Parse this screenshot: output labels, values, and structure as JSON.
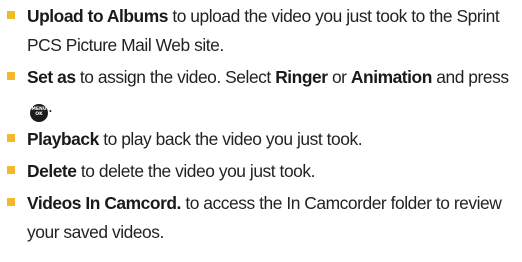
{
  "colors": {
    "bullet": "#f2b92c",
    "text": "#222222",
    "key_fill": "#1c1c1c"
  },
  "items": [
    {
      "term": "Upload to Albums",
      "text": " to upload the video you just took to the Sprint PCS Picture Mail Web site."
    },
    {
      "term": "Set as",
      "text_a": " to assign the video. Select ",
      "term_b": "Ringer",
      "text_b": " or ",
      "term_c": "Animation",
      "text_c": " and press",
      "key_icon": "menu-ok-key-icon",
      "key_line1": "MENU",
      "key_line2": "OK",
      "text_d": "."
    },
    {
      "term": "Playback",
      "text": " to play back the video you just took."
    },
    {
      "term": "Delete",
      "text": " to delete the video you just took."
    },
    {
      "term": "Videos In Camcord.",
      "text": " to access the In Camcorder folder to review your saved videos."
    }
  ]
}
